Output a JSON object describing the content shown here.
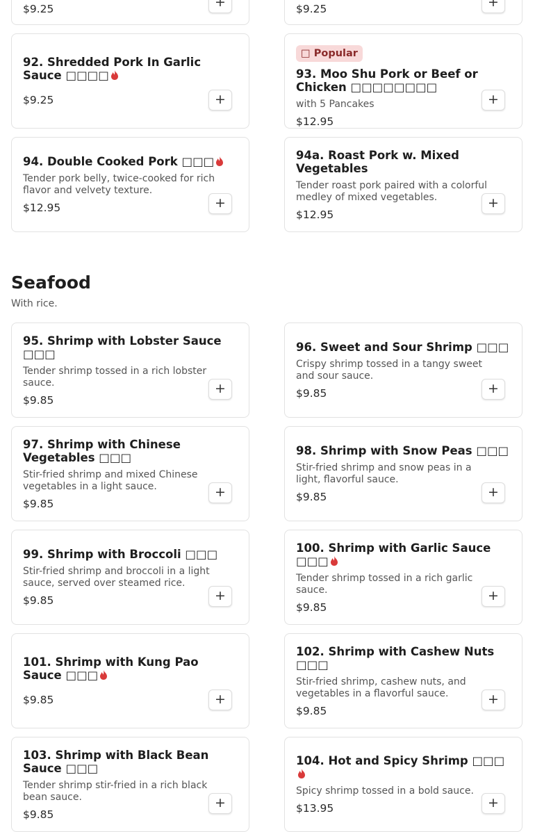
{
  "colors": {
    "accent_fire": "#d93a3a",
    "badge_bg": "#f8d9d9",
    "badge_text": "#8a2a2a",
    "border": "#e2e2e2"
  },
  "add_label": "+",
  "top_cards": [
    {
      "price": "$9.25"
    },
    {
      "price": "$9.25"
    }
  ],
  "pork_items": [
    {
      "title": "92. Shredded Pork In Garlic Sauce □□□□",
      "price": "$9.25",
      "spicy": true
    },
    {
      "badge": "□ Popular",
      "title": "93. Moo Shu Pork or Beef or Chicken □□□□□□□□",
      "desc": "with 5 Pancakes",
      "price": "$12.95"
    },
    {
      "title": "94. Double Cooked Pork □□□",
      "desc": "Tender pork belly, twice-cooked for rich flavor and velvety texture.",
      "price": "$12.95",
      "spicy": true
    },
    {
      "title": "94a. Roast Pork w. Mixed Vegetables",
      "desc": "Tender roast pork paired with a colorful medley of mixed vegetables.",
      "price": "$12.95"
    }
  ],
  "seafood": {
    "title": "Seafood",
    "subtitle": "With rice.",
    "items": [
      {
        "title": "95. Shrimp with Lobster Sauce □□□",
        "desc": "Tender shrimp tossed in a rich lobster sauce.",
        "price": "$9.85"
      },
      {
        "title": "96. Sweet and Sour Shrimp □□□",
        "desc": "Crispy shrimp tossed in a tangy sweet and sour sauce.",
        "price": "$9.85"
      },
      {
        "title": "97. Shrimp with Chinese Vegetables □□□",
        "desc": "Stir-fried shrimp and mixed Chinese vegetables in a light sauce.",
        "price": "$9.85"
      },
      {
        "title": "98. Shrimp with Snow Peas □□□",
        "desc": "Stir-fried shrimp and snow peas in a light, flavorful sauce.",
        "price": "$9.85"
      },
      {
        "title": "99. Shrimp with Broccoli □□□",
        "desc": "Stir-fried shrimp and broccoli in a light sauce, served over steamed rice.",
        "price": "$9.85"
      },
      {
        "title": "100. Shrimp with Garlic Sauce □□□",
        "desc": "Tender shrimp tossed in a rich garlic sauce.",
        "price": "$9.85",
        "spicy": true
      },
      {
        "title": "101. Shrimp with Kung Pao Sauce □□□",
        "price": "$9.85",
        "spicy": true
      },
      {
        "title": "102. Shrimp with Cashew Nuts □□□",
        "desc": "Stir-fried shrimp, cashew nuts, and vegetables in a flavorful sauce.",
        "price": "$9.85"
      },
      {
        "title": "103. Shrimp with Black Bean Sauce □□□",
        "desc": "Tender shrimp stir-fried in a rich black bean sauce.",
        "price": "$9.85"
      },
      {
        "title": "104. Hot and Spicy Shrimp □□□",
        "desc": "Spicy shrimp tossed in a bold sauce.",
        "price": "$13.95",
        "spicy": true
      }
    ]
  }
}
